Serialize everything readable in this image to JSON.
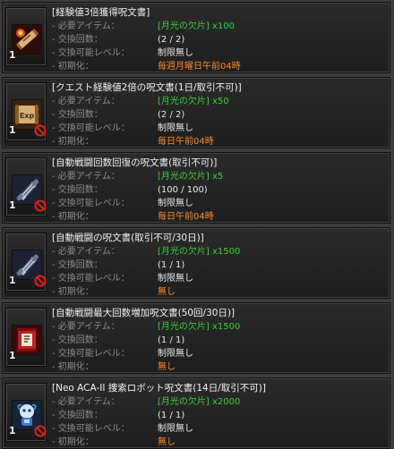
{
  "labels": {
    "required_item": "- 必要アイテム：",
    "exchange_count": "- 交換回数：",
    "exchange_level": "- 交換可能レベル：",
    "reset": "- 初期化："
  },
  "items": [
    {
      "title": "[経験値3倍獲得呪文書]",
      "required": "[月光の欠片] x100",
      "count": "(2 / 2)",
      "level": "制限無し",
      "reset": "毎週月曜日午前04時",
      "quantity": "1",
      "icon": "scroll-fire-icon",
      "untradeable": false
    },
    {
      "title": "[クエスト経験値2倍の呪文書(1日/取引不可)]",
      "required": "[月光の欠片] x50",
      "count": "(2 / 2)",
      "level": "制限無し",
      "reset": "毎日午前04時",
      "quantity": "1",
      "icon": "exp-scroll-icon",
      "icon_text": "Exp",
      "untradeable": true
    },
    {
      "title": "[自動戦闘回数回復の呪文書(取引不可)]",
      "required": "[月光の欠片] x5",
      "count": "(100 / 100)",
      "level": "制限無し",
      "reset": "毎日午前04時",
      "quantity": "1",
      "icon": "auto-battle-scroll-icon",
      "untradeable": true
    },
    {
      "title": "[自動戦闘の呪文書(取引不可/30日)]",
      "required": "[月光の欠片] x1500",
      "count": "(1 / 1)",
      "level": "制限無し",
      "reset": "無し",
      "quantity": "1",
      "icon": "auto-battle-scroll-icon",
      "untradeable": true
    },
    {
      "title": "[自動戦闘最大回数増加呪文書(50回/30日)]",
      "required": "[月光の欠片] x1500",
      "count": "(1 / 1)",
      "level": "制限無し",
      "reset": "無し",
      "quantity": "1",
      "icon": "red-scroll-icon",
      "untradeable": false
    },
    {
      "title": "[Neo ACA-II 捜索ロボット呪文書(14日/取引不可)]",
      "required": "[月光の欠片] x2000",
      "count": "(1 / 1)",
      "level": "制限無し",
      "reset": "無し",
      "quantity": "1",
      "icon": "robot-icon",
      "untradeable": true
    }
  ],
  "colors": {
    "title": "#f2f2f2",
    "label": "#8c8c8c",
    "required": "#39d039",
    "reset": "#ff8a2a"
  }
}
